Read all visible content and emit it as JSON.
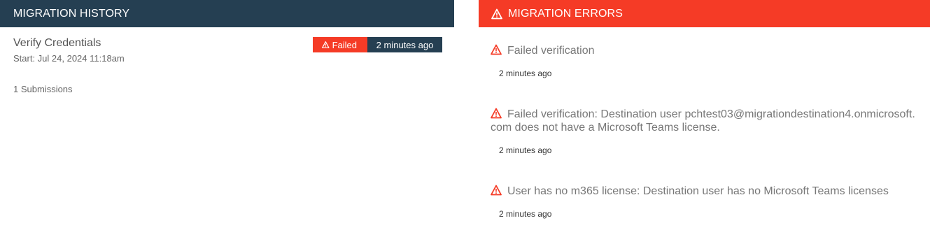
{
  "history": {
    "header": "MIGRATION HISTORY",
    "entry": {
      "title": "Verify Credentials",
      "start": "Start: Jul 24, 2024 11:18am",
      "status": "Failed",
      "time": "2 minutes ago",
      "submissions": "1 Submissions"
    }
  },
  "errors": {
    "header": "MIGRATION ERRORS",
    "items": [
      {
        "message": "Failed verification",
        "time": "2 minutes ago"
      },
      {
        "message": "Failed verification: Destination user pchtest03@migrationdestination4.onmicrosoft.com does not have a Microsoft Teams license.",
        "time": "2 minutes ago"
      },
      {
        "message": "User has no m365 license: Destination user has no Microsoft Teams licenses",
        "time": "2 minutes ago"
      }
    ]
  },
  "colors": {
    "header_dark": "#253f52",
    "error_red": "#f53b26"
  },
  "icons": {
    "warning": "warning-triangle-icon"
  }
}
